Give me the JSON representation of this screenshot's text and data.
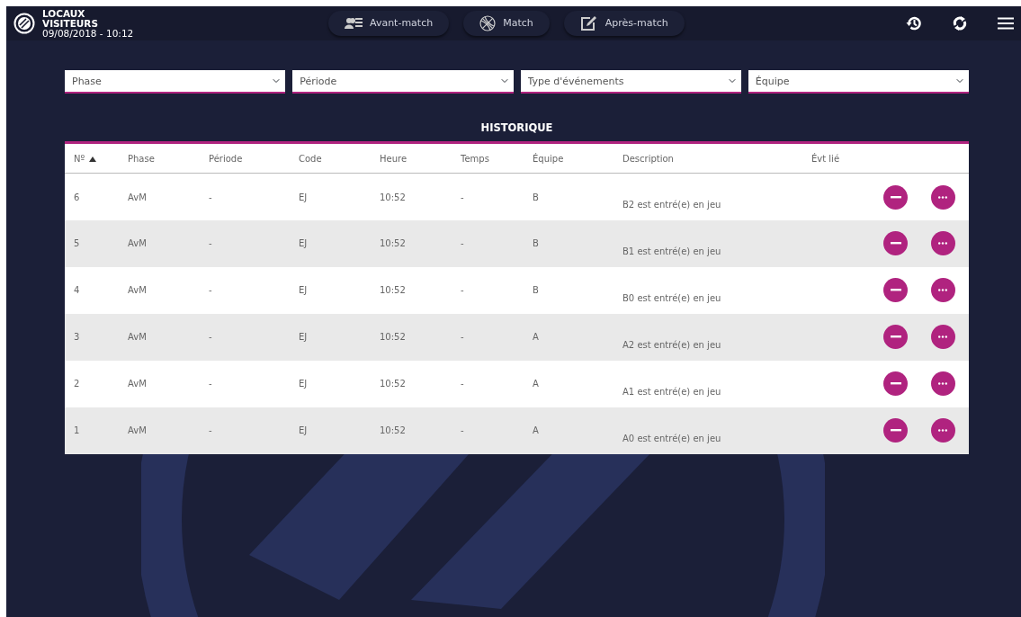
{
  "header": {
    "team_home": "LOCAUX",
    "team_away": "VISITEURS",
    "datetime": "09/08/2018 - 10:12",
    "tabs": [
      {
        "label": "Avant-match",
        "kind": "roster",
        "selected": false
      },
      {
        "label": "Match",
        "kind": "ball",
        "selected": false
      },
      {
        "label": "Après-match",
        "kind": "edit",
        "selected": false
      }
    ]
  },
  "filters": [
    {
      "placeholder": "Phase"
    },
    {
      "placeholder": "Période"
    },
    {
      "placeholder": "Type d'événements"
    },
    {
      "placeholder": "Équipe"
    }
  ],
  "table": {
    "title": "HISTORIQUE",
    "columns": [
      {
        "label": "Nº",
        "sorted": true
      },
      {
        "label": "Phase"
      },
      {
        "label": "Période"
      },
      {
        "label": "Code"
      },
      {
        "label": "Heure"
      },
      {
        "label": "Temps"
      },
      {
        "label": "Équipe"
      },
      {
        "label": "Description"
      },
      {
        "label": "Évt lié"
      }
    ],
    "rows": [
      {
        "cells": [
          "6",
          "AvM",
          "-",
          "EJ",
          "10:52",
          "-",
          "B",
          "B2 est entré(e) en jeu",
          ""
        ]
      },
      {
        "cells": [
          "5",
          "AvM",
          "-",
          "EJ",
          "10:52",
          "-",
          "B",
          "B1 est entré(e) en jeu",
          ""
        ]
      },
      {
        "cells": [
          "4",
          "AvM",
          "-",
          "EJ",
          "10:52",
          "-",
          "B",
          "B0 est entré(e) en jeu",
          ""
        ]
      },
      {
        "cells": [
          "3",
          "AvM",
          "-",
          "EJ",
          "10:52",
          "-",
          "A",
          "A2 est entré(e) en jeu",
          ""
        ]
      },
      {
        "cells": [
          "2",
          "AvM",
          "-",
          "EJ",
          "10:52",
          "-",
          "A",
          "A1 est entré(e) en jeu",
          ""
        ]
      },
      {
        "cells": [
          "1",
          "AvM",
          "-",
          "EJ",
          "10:52",
          "-",
          "A",
          "A0 est entré(e) en jeu",
          ""
        ]
      }
    ]
  }
}
